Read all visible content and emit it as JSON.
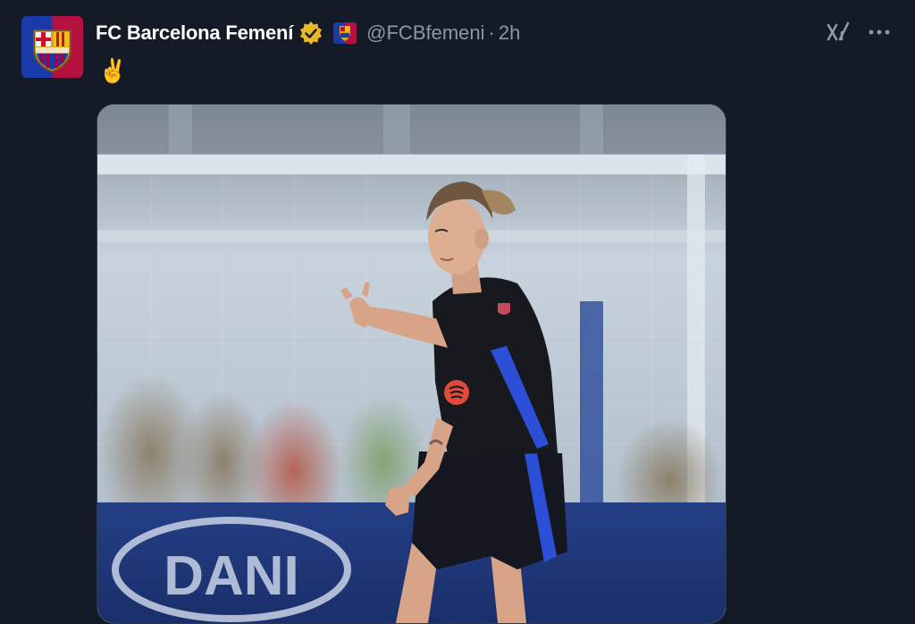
{
  "tweet": {
    "display_name": "FC Barcelona Femení",
    "handle": "@FCBfemeni",
    "separator": "·",
    "time": "2h",
    "text": "✌️",
    "icons": {
      "avatar": "fc-barcelona-crest-icon",
      "verified": "gold-verified-badge-icon",
      "affiliation": "fc-barcelona-affiliation-icon",
      "grok": "grok-icon",
      "more": "more-options-icon"
    },
    "media": {
      "kind": "photo",
      "banner_text": "DANI"
    }
  },
  "colors": {
    "background": "#141b26",
    "name": "#ffffff",
    "muted": "#8b98a5",
    "verified_gold": "#e8b829",
    "barca_blue": "#1a3aa8",
    "barca_red": "#b3123f"
  }
}
